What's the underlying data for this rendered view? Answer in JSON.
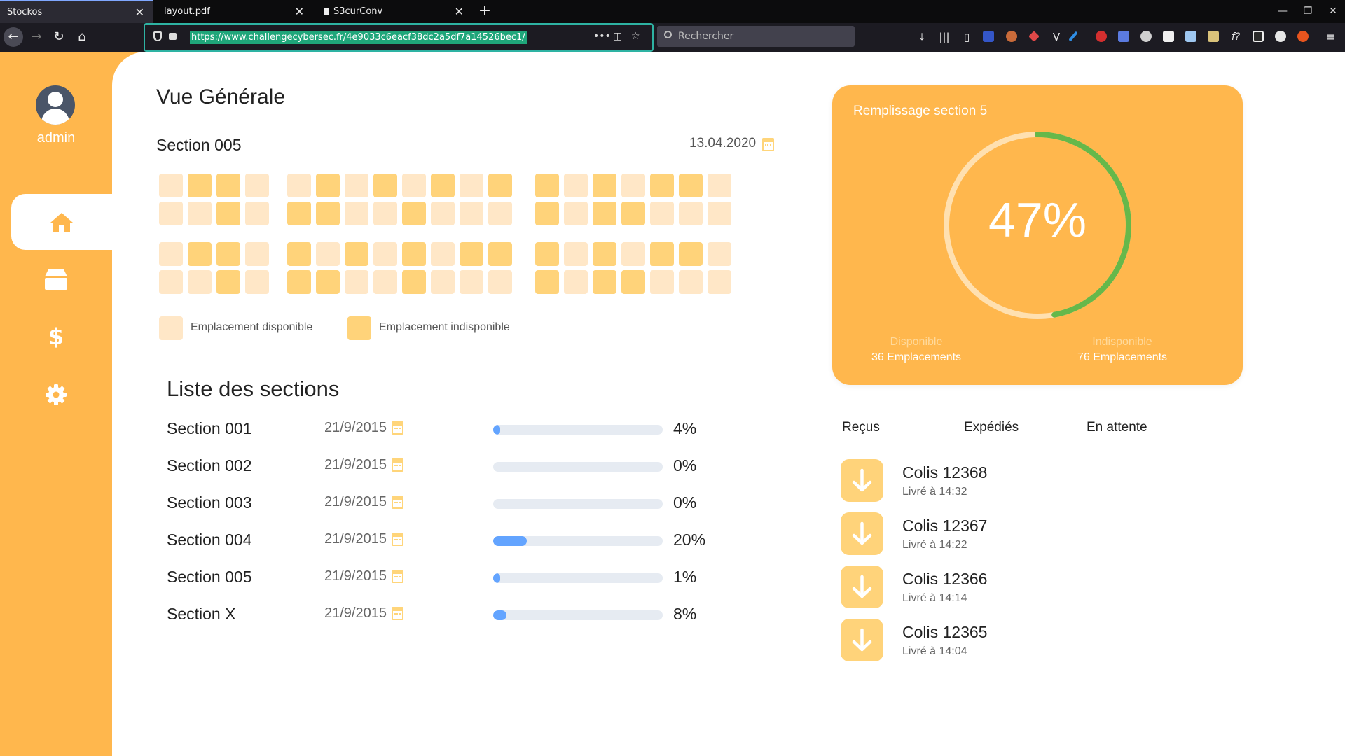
{
  "browser": {
    "tabs": [
      {
        "title": "Stockos",
        "active": true
      },
      {
        "title": "layout.pdf",
        "active": false
      },
      {
        "title": "S3curConv",
        "active": false
      }
    ],
    "url": "https://www.challengecybersec.fr/4e9033c6eacf38dc2a5df7a14526bec1/",
    "search_placeholder": "Rechercher"
  },
  "sidebar": {
    "user": "admin",
    "items": [
      {
        "name": "home",
        "icon": "home-icon",
        "active": true
      },
      {
        "name": "stock",
        "icon": "box-icon",
        "active": false
      },
      {
        "name": "finance",
        "icon": "dollar-icon",
        "active": false
      },
      {
        "name": "settings",
        "icon": "gear-icon",
        "active": false
      }
    ]
  },
  "overview": {
    "title": "Vue Générale",
    "section_title": "Section 005",
    "date": "13.04.2020",
    "slot_rows": [
      "0110 01010101 1010110",
      "0010 11001000 1011000",
      "0110 10101011 1010110",
      "0010 11001000 1011000"
    ],
    "legend": {
      "free": "Emplacement disponible",
      "taken": "Emplacement indisponible"
    }
  },
  "sections": {
    "title": "Liste des sections",
    "rows": [
      {
        "name": "Section 001",
        "date": "21/9/2015",
        "percent": "4%",
        "fraction": 0.04
      },
      {
        "name": "Section 002",
        "date": "21/9/2015",
        "percent": "0%",
        "fraction": 0.0
      },
      {
        "name": "Section 003",
        "date": "21/9/2015",
        "percent": "0%",
        "fraction": 0.0
      },
      {
        "name": "Section 004",
        "date": "21/9/2015",
        "percent": "20%",
        "fraction": 0.2
      },
      {
        "name": "Section 005",
        "date": "21/9/2015",
        "percent": "1%",
        "fraction": 0.01
      },
      {
        "name": "Section X",
        "date": "21/9/2015",
        "percent": "8%",
        "fraction": 0.08
      }
    ]
  },
  "fill_card": {
    "title": "Remplissage section 5",
    "percent": "47%",
    "fraction": 0.47,
    "available_label": "Disponible",
    "available_value": "36 Emplacements",
    "unavailable_label": "Indisponible",
    "unavailable_value": "76 Emplacements"
  },
  "parcels": {
    "tabs": [
      "Reçus",
      "Expédiés",
      "En attente"
    ],
    "items": [
      {
        "name": "Colis 12368",
        "time": "Livré à 14:32"
      },
      {
        "name": "Colis 12367",
        "time": "Livré à 14:22"
      },
      {
        "name": "Colis 12366",
        "time": "Livré à 14:14"
      },
      {
        "name": "Colis 12365",
        "time": "Livré à 14:04"
      }
    ]
  },
  "colors": {
    "accent": "#ffb74d",
    "slot_free": "#ffe7c7",
    "slot_taken": "#ffd37a",
    "progress": "#63a4ff",
    "gauge": "#66b84a"
  }
}
